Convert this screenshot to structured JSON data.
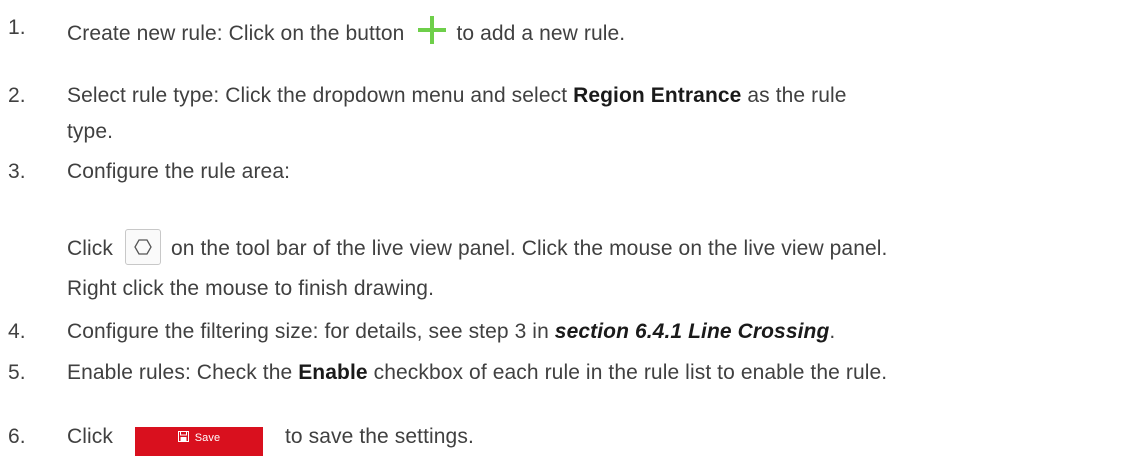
{
  "steps": [
    {
      "num": "1.",
      "before": "Create new rule: Click on the button",
      "after": "to add a new rule.",
      "icon": "plus-icon"
    },
    {
      "num": "2.",
      "before": "Select rule type: Click the dropdown menu and select ",
      "bold": "Region Entrance",
      "after": " as the rule",
      "line2": "type."
    },
    {
      "num": "3.",
      "text": "Configure the rule area:",
      "sub1_before": "Click",
      "sub1_after": "on the tool bar of the live view panel. Click the mouse on the live view panel.",
      "sub2": "Right click the mouse to finish drawing.",
      "icon": "polygon-icon"
    },
    {
      "num": "4.",
      "before": "Configure the filtering size: for details, see step 3 in ",
      "italic": "section 6.4.1 Line Crossing",
      "after": "."
    },
    {
      "num": "5.",
      "before": "Enable rules: Check the ",
      "bold": "Enable",
      "after": " checkbox of each rule in the rule list to enable the rule."
    },
    {
      "num": "6.",
      "before": "Click",
      "button_label": "Save",
      "after": "to save the settings."
    }
  ],
  "colors": {
    "text": "#404040",
    "plus_icon": "#6ecf4a",
    "save_button": "#d9101e"
  }
}
